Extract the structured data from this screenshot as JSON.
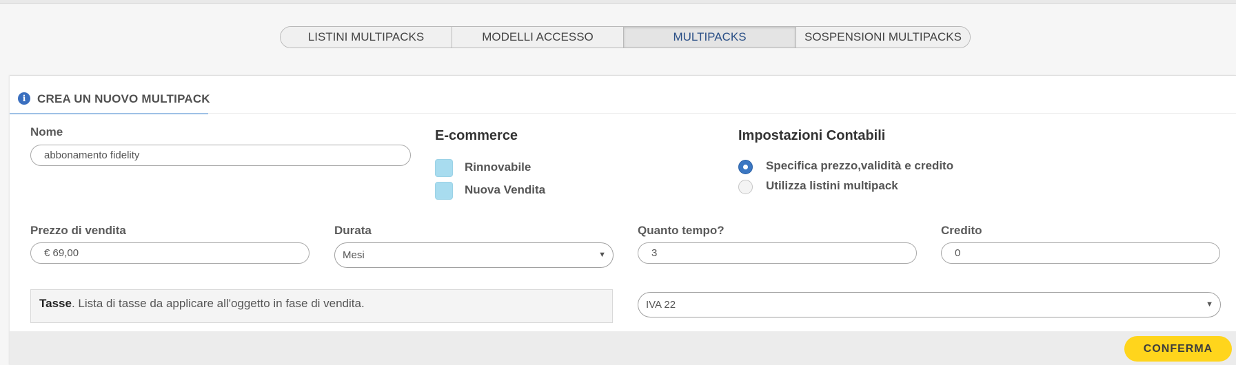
{
  "tabs": [
    {
      "label": "LISTINI MULTIPACKS",
      "active": false
    },
    {
      "label": "MODELLI ACCESSO",
      "active": false
    },
    {
      "label": "MULTIPACKS",
      "active": true
    },
    {
      "label": "SOSPENSIONI MULTIPACKS",
      "active": false
    }
  ],
  "panel": {
    "title": "CREA UN NUOVO MULTIPACK",
    "info_icon": "info-icon"
  },
  "nome": {
    "label": "Nome",
    "value": "abbonamento fidelity"
  },
  "ecommerce": {
    "title": "E-commerce",
    "options": [
      "Rinnovabile",
      "Nuova Vendita"
    ],
    "checkbox_color": "#a8dcef"
  },
  "contabili": {
    "title": "Impostazioni Contabili",
    "options": [
      {
        "label": "Specifica prezzo,validità e credito",
        "selected": true
      },
      {
        "label": "Utilizza listini multipack",
        "selected": false
      }
    ]
  },
  "prezzo": {
    "label": "Prezzo di vendita",
    "value": "€ 69,00"
  },
  "durata": {
    "label": "Durata",
    "value": "Mesi"
  },
  "quanto": {
    "label": "Quanto tempo?",
    "value": "3"
  },
  "credito": {
    "label": "Credito",
    "value": "0"
  },
  "tasse": {
    "bold": "Tasse",
    "text": ". Lista di tasse da applicare all'oggetto in fase di vendita.",
    "value": "IVA 22"
  },
  "confirm_label": "CONFERMA",
  "colors": {
    "accent": "#3b77c2",
    "confirm": "#ffd51c",
    "active_tab_text": "#2a4f86"
  }
}
